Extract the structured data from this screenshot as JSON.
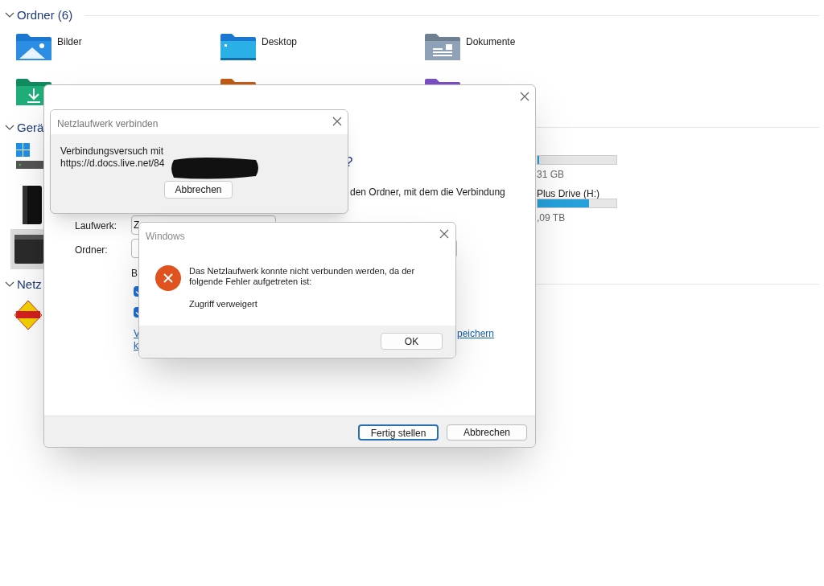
{
  "explorer": {
    "sections": [
      {
        "title": "Ordner (6)",
        "expanded": true
      },
      {
        "title": "Gerä",
        "expanded": true
      },
      {
        "title": "Netz",
        "expanded": true
      }
    ],
    "folders": [
      {
        "name": "Bilder",
        "kind": "pictures"
      },
      {
        "name": "Desktop",
        "kind": "desktop"
      },
      {
        "name": "Dokumente",
        "kind": "documents"
      },
      {
        "kind": "downloads"
      },
      {
        "kind": "music"
      },
      {
        "kind": "videos"
      }
    ],
    "drives": [
      {
        "level": 0.02,
        "size_text": "31 GB"
      },
      {
        "label": "Plus Drive (H:)",
        "level": 0.65,
        "size_text": ",09 TB"
      }
    ]
  },
  "map_drive_dialog": {
    "heading_fragment": "?",
    "description_fragment": "den Ordner, mit dem die Verbindung",
    "fields": [
      {
        "label": "Laufwerk:",
        "value": "Z"
      },
      {
        "label": "Ordner:"
      }
    ],
    "browse_fragment": "B",
    "checkboxes": [
      {
        "checked": true
      },
      {
        "checked": true
      }
    ],
    "link_fragments": [
      "V",
      "k"
    ],
    "link_tail": "peichern",
    "buttons": [
      {
        "label": "Fertig stellen",
        "default": true
      },
      {
        "label": "Abbrechen",
        "default": false
      }
    ]
  },
  "progress_dialog": {
    "title": "Netzlaufwerk verbinden",
    "message": "Verbindungsversuch mit\nhttps://d.docs.live.net/84",
    "button": "Abbrechen"
  },
  "error_dialog": {
    "title": "Windows",
    "message": "Das Netzlaufwerk konnte nicht verbunden werden, da der folgende Fehler aufgetreten ist:",
    "detail": "Zugriff verweigert",
    "button": "OK"
  }
}
